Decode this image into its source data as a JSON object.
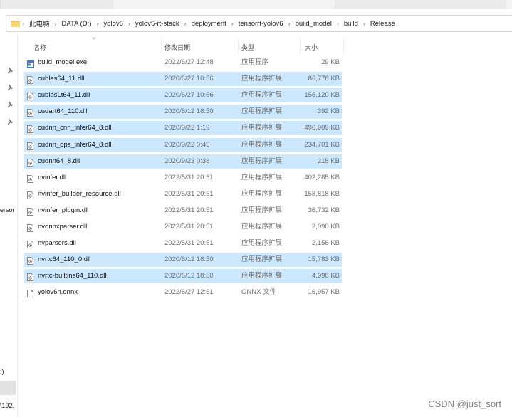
{
  "path": [
    "此电脑",
    "DATA (D:)",
    "yolov6",
    "yolov5-rt-stack",
    "deployment",
    "tensorrt-yolov6",
    "build_model",
    "build",
    "Release"
  ],
  "columns": {
    "name": "名称",
    "date": "修改日期",
    "type": "类型",
    "size": "大小"
  },
  "files": [
    {
      "name": "build_model.exe",
      "date": "2022/6/27 12:48",
      "type": "应用程序",
      "size": "29 KB",
      "selected": false,
      "icon": "exe-icon"
    },
    {
      "name": "cublas64_11.dll",
      "date": "2020/6/27 10:56",
      "type": "应用程序扩展",
      "size": "86,778 KB",
      "selected": true,
      "icon": "dll-icon"
    },
    {
      "name": "cublasLt64_11.dll",
      "date": "2020/6/27 10:56",
      "type": "应用程序扩展",
      "size": "156,120 KB",
      "selected": true,
      "icon": "dll-icon"
    },
    {
      "name": "cudart64_110.dll",
      "date": "2020/6/12 18:50",
      "type": "应用程序扩展",
      "size": "392 KB",
      "selected": true,
      "icon": "dll-icon"
    },
    {
      "name": "cudnn_cnn_infer64_8.dll",
      "date": "2020/9/23 1:19",
      "type": "应用程序扩展",
      "size": "496,909 KB",
      "selected": true,
      "icon": "dll-icon"
    },
    {
      "name": "cudnn_ops_infer64_8.dll",
      "date": "2020/9/23 0:45",
      "type": "应用程序扩展",
      "size": "234,701 KB",
      "selected": true,
      "icon": "dll-icon"
    },
    {
      "name": "cudnn64_8.dll",
      "date": "2020/9/23 0:38",
      "type": "应用程序扩展",
      "size": "218 KB",
      "selected": true,
      "icon": "dll-icon"
    },
    {
      "name": "nvinfer.dll",
      "date": "2022/5/31 20:51",
      "type": "应用程序扩展",
      "size": "402,285 KB",
      "selected": false,
      "icon": "dll-icon"
    },
    {
      "name": "nvinfer_builder_resource.dll",
      "date": "2022/5/31 20:51",
      "type": "应用程序扩展",
      "size": "158,818 KB",
      "selected": false,
      "icon": "dll-icon"
    },
    {
      "name": "nvinfer_plugin.dll",
      "date": "2022/5/31 20:51",
      "type": "应用程序扩展",
      "size": "36,732 KB",
      "selected": false,
      "icon": "dll-icon"
    },
    {
      "name": "nvonnxparser.dll",
      "date": "2022/5/31 20:51",
      "type": "应用程序扩展",
      "size": "2,090 KB",
      "selected": false,
      "icon": "dll-icon"
    },
    {
      "name": "nvparsers.dll",
      "date": "2022/5/31 20:51",
      "type": "应用程序扩展",
      "size": "2,156 KB",
      "selected": false,
      "icon": "dll-icon"
    },
    {
      "name": "nvrtc64_110_0.dll",
      "date": "2020/6/12 18:50",
      "type": "应用程序扩展",
      "size": "15,783 KB",
      "selected": true,
      "icon": "dll-icon"
    },
    {
      "name": "nvrtc-builtins64_110.dll",
      "date": "2020/6/12 18:50",
      "type": "应用程序扩展",
      "size": "4,998 KB",
      "selected": true,
      "icon": "dll-icon"
    },
    {
      "name": "yolov6n.onnx",
      "date": "2022/6/27 12:51",
      "type": "ONNX 文件",
      "size": "16,957 KB",
      "selected": false,
      "icon": "file-icon"
    }
  ],
  "left_pane": {
    "fragment_1": "ersor",
    "fragment_2": ":)",
    "fragment_3": "\\192."
  },
  "watermark": "CSDN @just_sort",
  "colors": {
    "selection": "#cce8ff",
    "folder": "#f2c14e",
    "exe": "#3a7bd5"
  }
}
